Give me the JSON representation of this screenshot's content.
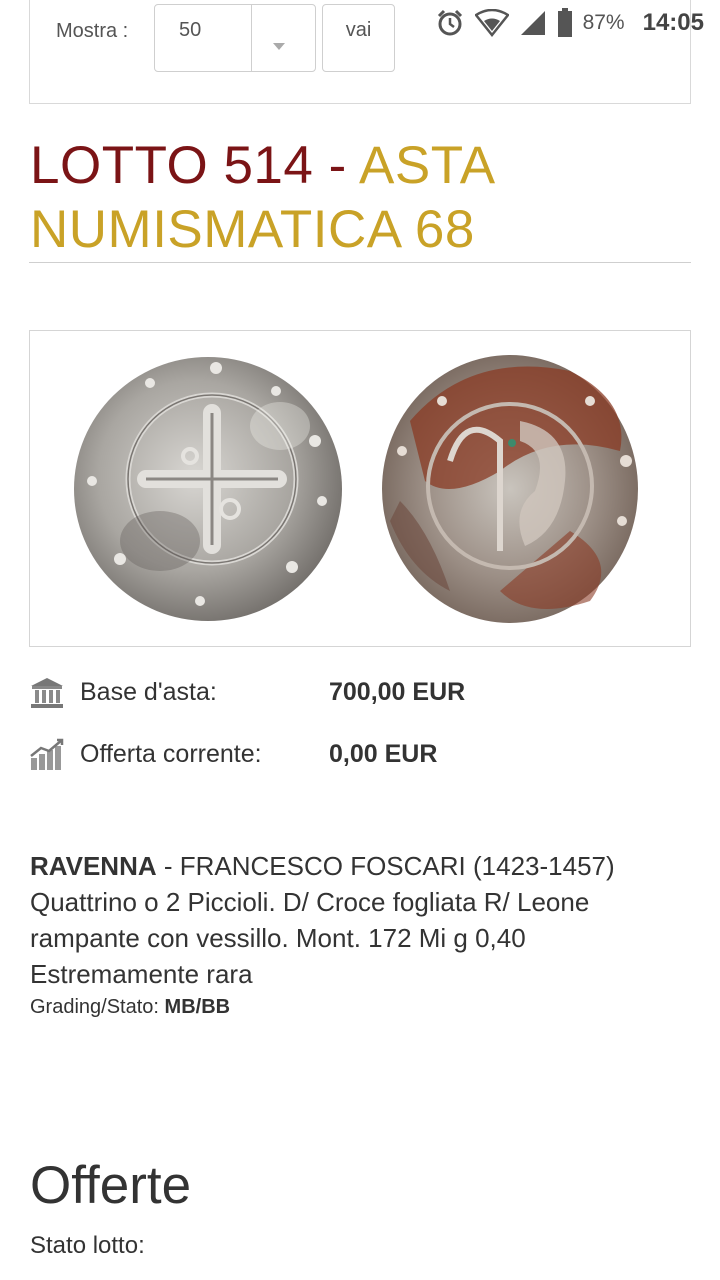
{
  "status_bar": {
    "battery_percent": "87%",
    "time": "14:05",
    "icons": [
      "alarm-icon",
      "wifi-icon",
      "signal-icon",
      "battery-icon"
    ]
  },
  "filter": {
    "label": "Mostra :",
    "select_value": "50",
    "go_label": "vai"
  },
  "lot": {
    "title_lot": "LOTTO 514 - ",
    "title_auction": "ASTA NUMISMATICA 68"
  },
  "prices": {
    "base_label": "Base d'asta:",
    "base_value": "700,00 EUR",
    "current_label": "Offerta corrente:",
    "current_value": "0,00 EUR"
  },
  "description": {
    "place": "RAVENNA",
    "text": " - FRANCESCO FOSCARI (1423-1457) Quattrino o 2 Piccioli. D/ Croce fogliata R/ Leone rampante con vessillo. Mont. 172 Mi g 0,40 Estremamente rara",
    "grading_label": "Grading/Stato: ",
    "grading_value": "MB/BB"
  },
  "offers": {
    "title": "Offerte",
    "status_label": "Stato lotto:"
  },
  "colors": {
    "title_red": "#7b1416",
    "title_gold": "#c9a227"
  }
}
